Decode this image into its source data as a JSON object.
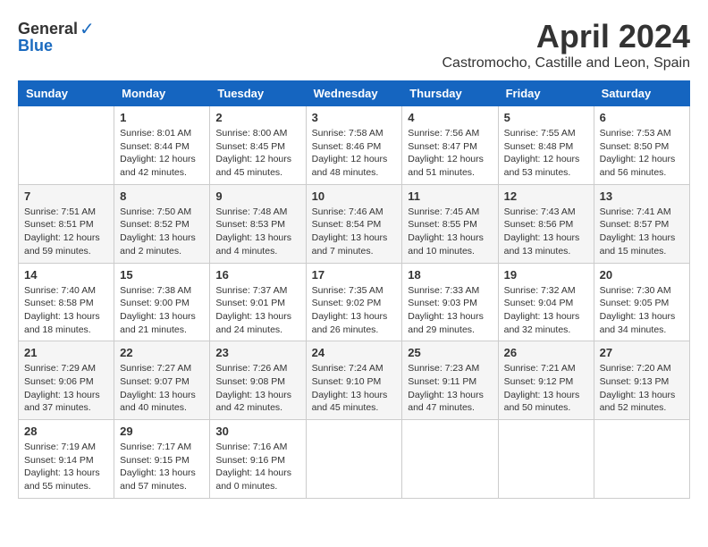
{
  "header": {
    "logo_general": "General",
    "logo_blue": "Blue",
    "month_title": "April 2024",
    "location": "Castromocho, Castille and Leon, Spain"
  },
  "days_of_week": [
    "Sunday",
    "Monday",
    "Tuesday",
    "Wednesday",
    "Thursday",
    "Friday",
    "Saturday"
  ],
  "weeks": [
    [
      {
        "day": "",
        "info": ""
      },
      {
        "day": "1",
        "info": "Sunrise: 8:01 AM\nSunset: 8:44 PM\nDaylight: 12 hours\nand 42 minutes."
      },
      {
        "day": "2",
        "info": "Sunrise: 8:00 AM\nSunset: 8:45 PM\nDaylight: 12 hours\nand 45 minutes."
      },
      {
        "day": "3",
        "info": "Sunrise: 7:58 AM\nSunset: 8:46 PM\nDaylight: 12 hours\nand 48 minutes."
      },
      {
        "day": "4",
        "info": "Sunrise: 7:56 AM\nSunset: 8:47 PM\nDaylight: 12 hours\nand 51 minutes."
      },
      {
        "day": "5",
        "info": "Sunrise: 7:55 AM\nSunset: 8:48 PM\nDaylight: 12 hours\nand 53 minutes."
      },
      {
        "day": "6",
        "info": "Sunrise: 7:53 AM\nSunset: 8:50 PM\nDaylight: 12 hours\nand 56 minutes."
      }
    ],
    [
      {
        "day": "7",
        "info": "Sunrise: 7:51 AM\nSunset: 8:51 PM\nDaylight: 12 hours\nand 59 minutes."
      },
      {
        "day": "8",
        "info": "Sunrise: 7:50 AM\nSunset: 8:52 PM\nDaylight: 13 hours\nand 2 minutes."
      },
      {
        "day": "9",
        "info": "Sunrise: 7:48 AM\nSunset: 8:53 PM\nDaylight: 13 hours\nand 4 minutes."
      },
      {
        "day": "10",
        "info": "Sunrise: 7:46 AM\nSunset: 8:54 PM\nDaylight: 13 hours\nand 7 minutes."
      },
      {
        "day": "11",
        "info": "Sunrise: 7:45 AM\nSunset: 8:55 PM\nDaylight: 13 hours\nand 10 minutes."
      },
      {
        "day": "12",
        "info": "Sunrise: 7:43 AM\nSunset: 8:56 PM\nDaylight: 13 hours\nand 13 minutes."
      },
      {
        "day": "13",
        "info": "Sunrise: 7:41 AM\nSunset: 8:57 PM\nDaylight: 13 hours\nand 15 minutes."
      }
    ],
    [
      {
        "day": "14",
        "info": "Sunrise: 7:40 AM\nSunset: 8:58 PM\nDaylight: 13 hours\nand 18 minutes."
      },
      {
        "day": "15",
        "info": "Sunrise: 7:38 AM\nSunset: 9:00 PM\nDaylight: 13 hours\nand 21 minutes."
      },
      {
        "day": "16",
        "info": "Sunrise: 7:37 AM\nSunset: 9:01 PM\nDaylight: 13 hours\nand 24 minutes."
      },
      {
        "day": "17",
        "info": "Sunrise: 7:35 AM\nSunset: 9:02 PM\nDaylight: 13 hours\nand 26 minutes."
      },
      {
        "day": "18",
        "info": "Sunrise: 7:33 AM\nSunset: 9:03 PM\nDaylight: 13 hours\nand 29 minutes."
      },
      {
        "day": "19",
        "info": "Sunrise: 7:32 AM\nSunset: 9:04 PM\nDaylight: 13 hours\nand 32 minutes."
      },
      {
        "day": "20",
        "info": "Sunrise: 7:30 AM\nSunset: 9:05 PM\nDaylight: 13 hours\nand 34 minutes."
      }
    ],
    [
      {
        "day": "21",
        "info": "Sunrise: 7:29 AM\nSunset: 9:06 PM\nDaylight: 13 hours\nand 37 minutes."
      },
      {
        "day": "22",
        "info": "Sunrise: 7:27 AM\nSunset: 9:07 PM\nDaylight: 13 hours\nand 40 minutes."
      },
      {
        "day": "23",
        "info": "Sunrise: 7:26 AM\nSunset: 9:08 PM\nDaylight: 13 hours\nand 42 minutes."
      },
      {
        "day": "24",
        "info": "Sunrise: 7:24 AM\nSunset: 9:10 PM\nDaylight: 13 hours\nand 45 minutes."
      },
      {
        "day": "25",
        "info": "Sunrise: 7:23 AM\nSunset: 9:11 PM\nDaylight: 13 hours\nand 47 minutes."
      },
      {
        "day": "26",
        "info": "Sunrise: 7:21 AM\nSunset: 9:12 PM\nDaylight: 13 hours\nand 50 minutes."
      },
      {
        "day": "27",
        "info": "Sunrise: 7:20 AM\nSunset: 9:13 PM\nDaylight: 13 hours\nand 52 minutes."
      }
    ],
    [
      {
        "day": "28",
        "info": "Sunrise: 7:19 AM\nSunset: 9:14 PM\nDaylight: 13 hours\nand 55 minutes."
      },
      {
        "day": "29",
        "info": "Sunrise: 7:17 AM\nSunset: 9:15 PM\nDaylight: 13 hours\nand 57 minutes."
      },
      {
        "day": "30",
        "info": "Sunrise: 7:16 AM\nSunset: 9:16 PM\nDaylight: 14 hours\nand 0 minutes."
      },
      {
        "day": "",
        "info": ""
      },
      {
        "day": "",
        "info": ""
      },
      {
        "day": "",
        "info": ""
      },
      {
        "day": "",
        "info": ""
      }
    ]
  ]
}
